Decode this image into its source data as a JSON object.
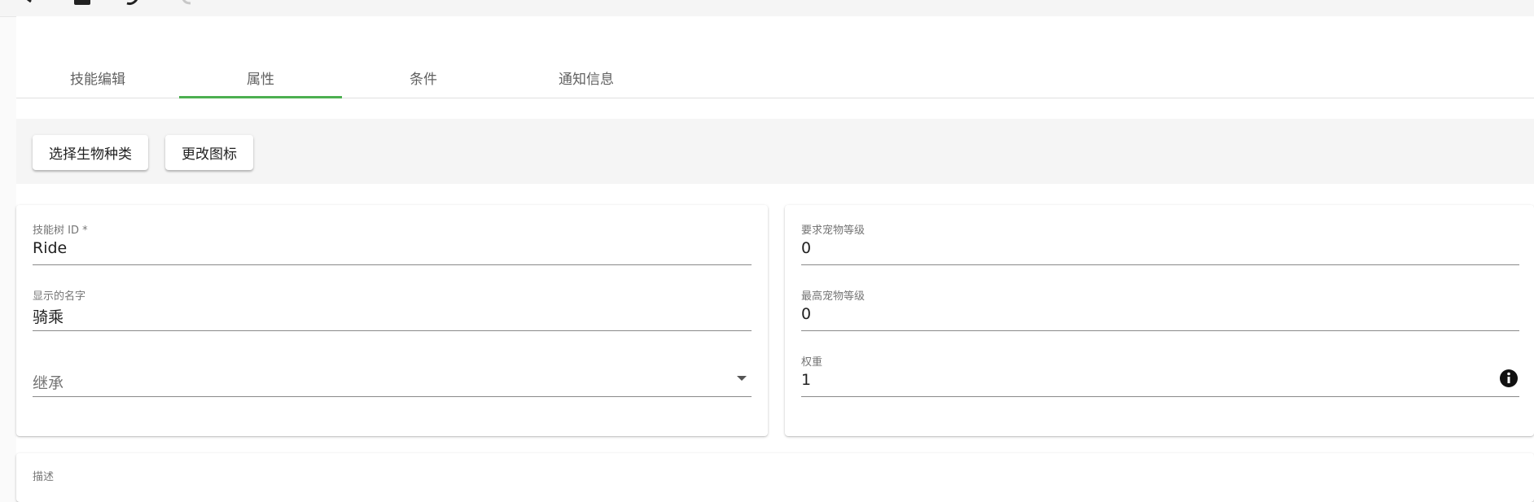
{
  "toolbar": {
    "icons": [
      "back-arrow-icon",
      "lock-icon",
      "undo-icon",
      "redo-icon"
    ]
  },
  "tabs": [
    {
      "label": "技能编辑"
    },
    {
      "label": "属性"
    },
    {
      "label": "条件"
    },
    {
      "label": "通知信息"
    }
  ],
  "active_tab": "属性",
  "actions": {
    "select_species": "选择生物种类",
    "change_icon": "更改图标"
  },
  "left_card": {
    "skill_tree_id": {
      "label": "技能树 ID *",
      "value": "Ride"
    },
    "display_name": {
      "label": "显示的名字",
      "value": "骑乘"
    },
    "inherit": {
      "placeholder": "继承"
    }
  },
  "right_card": {
    "required_pet_level": {
      "label": "要求宠物等级",
      "value": "0"
    },
    "max_pet_level": {
      "label": "最高宠物等级",
      "value": "0"
    },
    "weight": {
      "label": "权重",
      "value": "1"
    }
  },
  "description": {
    "label": "描述"
  },
  "colors": {
    "accent": "#4caf50",
    "background": "#fafafa",
    "panel": "#ffffff",
    "action_bar": "#f5f5f5"
  }
}
